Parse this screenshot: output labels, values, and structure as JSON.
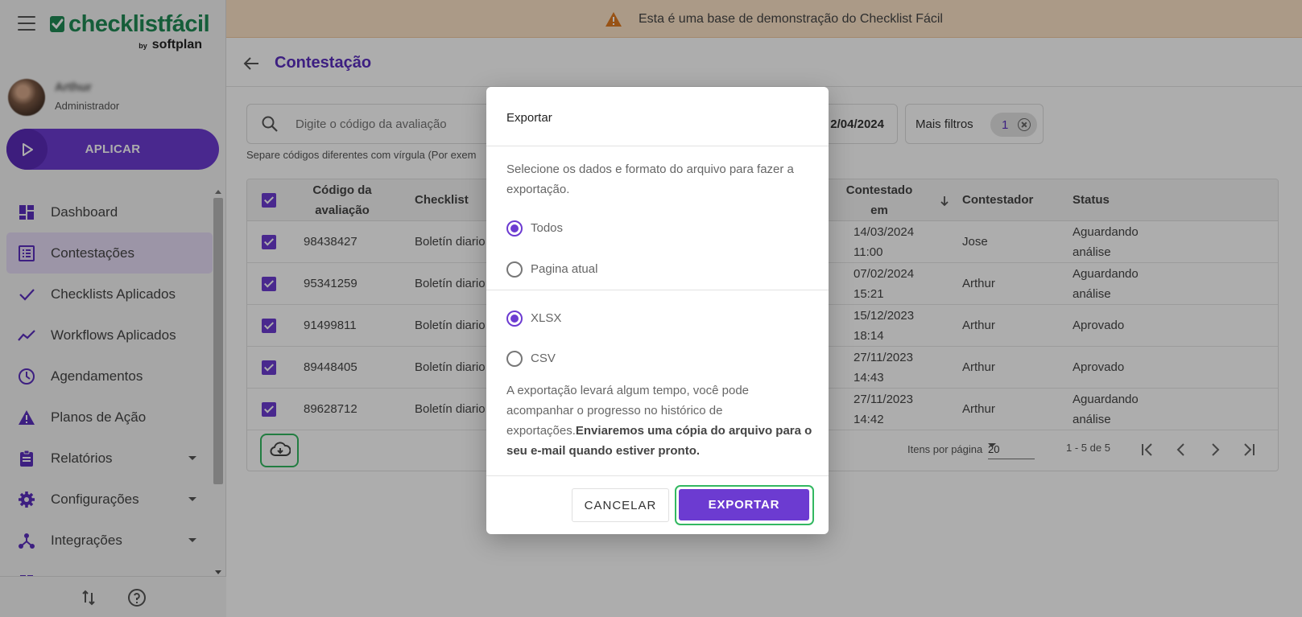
{
  "app": {
    "logo_word": "checklistfácil",
    "logo_by": "by",
    "logo_brand": "softplan"
  },
  "banner": {
    "text": "Esta é uma base de demonstração do Checklist Fácil",
    "icon": "warning-icon",
    "color": "#fde4c8"
  },
  "user": {
    "name": "Arthur",
    "role": "Administrador"
  },
  "sidebar": {
    "apply_label": "APLICAR",
    "items": [
      {
        "label": "Dashboard",
        "icon": "dashboard-icon"
      },
      {
        "label": "Contestações",
        "icon": "list-alt-icon",
        "active": true
      },
      {
        "label": "Checklists Aplicados",
        "icon": "check-icon"
      },
      {
        "label": "Workflows Aplicados",
        "icon": "trend-icon"
      },
      {
        "label": "Agendamentos",
        "icon": "clock-icon"
      },
      {
        "label": "Planos de Ação",
        "icon": "warning-icon"
      },
      {
        "label": "Relatórios",
        "icon": "clipboard-icon",
        "expandable": true
      },
      {
        "label": "Configurações",
        "icon": "gear-icon",
        "expandable": true
      },
      {
        "label": "Integrações",
        "icon": "hub-icon",
        "expandable": true
      }
    ]
  },
  "page": {
    "title": "Contestação"
  },
  "search": {
    "placeholder": "Digite o código da avaliação",
    "hint": "Separe códigos diferentes com vírgula (Por exem"
  },
  "filters": {
    "date_text": "2/04/2024",
    "more_label": "Mais filtros",
    "count": "1"
  },
  "table": {
    "headers": {
      "code_line1": "Código da",
      "code_line2": "avaliação",
      "checklist": "Checklist",
      "contested_line1": "Contestado",
      "contested_line2": "em",
      "contester": "Contestador",
      "status": "Status"
    },
    "rows": [
      {
        "code": "98438427",
        "checklist": "Boletín diario",
        "date": "14/03/2024",
        "time": "11:00",
        "contester": "Jose",
        "status1": "Aguardando",
        "status2": "análise"
      },
      {
        "code": "95341259",
        "checklist": "Boletín diario",
        "date": "07/02/2024",
        "time": "15:21",
        "contester": "Arthur",
        "status1": "Aguardando",
        "status2": "análise"
      },
      {
        "code": "91499811",
        "checklist": "Boletín diario",
        "date": "15/12/2023",
        "time": "18:14",
        "contester": "Arthur",
        "status1": "Aprovado",
        "status2": ""
      },
      {
        "code": "89448405",
        "checklist": "Boletín diario",
        "date": "27/11/2023",
        "time": "14:43",
        "contester": "Arthur",
        "status1": "Aprovado",
        "status2": ""
      },
      {
        "code": "89628712",
        "checklist": "Boletín diario",
        "date": "27/11/2023",
        "time": "14:42",
        "contester": "Arthur",
        "status1": "Aguardando",
        "status2": "análise"
      }
    ],
    "footer": {
      "items_per_page_label": "Itens por página",
      "items_per_page": "20",
      "range": "1 - 5 de 5"
    }
  },
  "modal": {
    "title": "Exportar",
    "description": "Selecione os dados e formato do arquivo para fazer a exportação.",
    "scope_options": [
      {
        "label": "Todos",
        "selected": true
      },
      {
        "label": "Pagina atual",
        "selected": false
      }
    ],
    "format_options": [
      {
        "label": "XLSX",
        "selected": true
      },
      {
        "label": "CSV",
        "selected": false
      }
    ],
    "note_regular": "A exportação levará algum tempo, você pode acompanhar o progresso no histórico de exportações.",
    "note_bold": "Enviaremos uma cópia do arquivo para o seu e-mail quando estiver pronto.",
    "cancel_label": "CANCELAR",
    "export_label": "EXPORTAR"
  },
  "colors": {
    "primary": "#6c3bd1",
    "highlight": "#33b861",
    "brand_green": "#1f8a55"
  }
}
